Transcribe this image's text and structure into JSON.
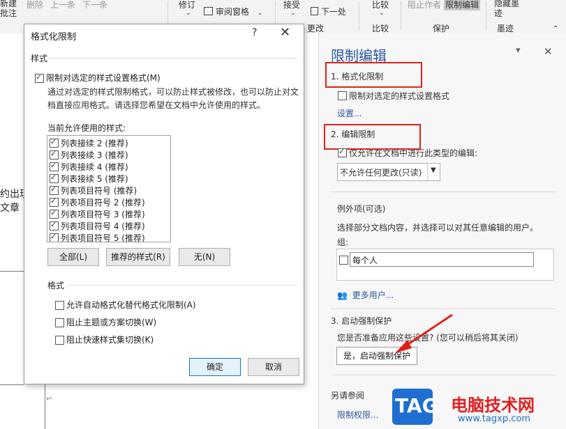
{
  "ribbon": {
    "new_comment": "新建\n批注",
    "delete": "删除",
    "prev": "上一条",
    "next_comment": "下一条",
    "track": "修订",
    "review_pane": "审阅窗格",
    "accept": "接受",
    "next": "下一处",
    "compare": "比较",
    "block_authors": "阻止作者",
    "restrict_editing": "限制编辑",
    "hide_ink": "隐藏墨\n迹",
    "group_changes": "更改",
    "group_compare": "比较",
    "group_protect": "保护",
    "group_ink": "墨迹"
  },
  "document": {
    "text1": "约出现",
    "text2": "文章（",
    "para_mark": "↵"
  },
  "dialog": {
    "title": "格式化限制",
    "help": "?",
    "close": "✕",
    "styles_section": "样式",
    "limit_checkbox_label": "限制对选定的样式设置格式(M)",
    "description": "通过对选定的样式限制格式，可以防止样式被修改，也可以防止对文档直接应用格式。请选择您希望在文档中允许使用的样式。",
    "allowed_label": "当前允许使用的样式:",
    "styles": [
      "列表接续 2 (推荐)",
      "列表接续 3 (推荐)",
      "列表接续 4 (推荐)",
      "列表接续 5 (推荐)",
      "列表项目符号 (推荐)",
      "列表项目符号 2 (推荐)",
      "列表项目符号 3 (推荐)",
      "列表项目符号 4 (推荐)",
      "列表项目符号 5 (推荐)"
    ],
    "btn_all": "全部(L)",
    "btn_recommended": "推荐的样式(R)",
    "btn_none": "无(N)",
    "format_section": "格式",
    "opt_autoformat": "允许自动格式化替代格式化限制(A)",
    "opt_theme": "阻止主题或方案切换(W)",
    "opt_quickstyle": "阻止快速样式集切换(K)",
    "ok": "确定",
    "cancel": "取消"
  },
  "pane": {
    "title": "限制编辑",
    "dropdown_icon": "▾",
    "close": "✕",
    "sec1": "1. 格式化限制",
    "sec1_checkbox": "限制对选定的样式设置格式",
    "settings_link": "设置...",
    "sec2": "2. 编辑限制",
    "sec2_checkbox": "仅允许在文档中进行此类型的编辑:",
    "edit_type_value": "不允许任何更改(只读)",
    "exceptions": "例外项(可选)",
    "exceptions_desc": "选择部分文档内容，并选择可以对其任意编辑的用户。",
    "groups_label": "组:",
    "everyone": "每个人",
    "more_users": "更多用户...",
    "sec3": "3. 启动强制保护",
    "sec3_desc": "您是否准备应用这些设置? (您可以稍后将其关闭)",
    "start_btn": "是，启动强制保护",
    "see_also": "另请参阅",
    "permissions_link": "限制权限..."
  },
  "watermark": {
    "badge": "TAG",
    "site_name": "电脑技术网",
    "url": "www.tagxp.com"
  },
  "colors": {
    "accent": "#2b579a",
    "annotation_red": "#e0201a",
    "watermark_red": "#e02020"
  }
}
